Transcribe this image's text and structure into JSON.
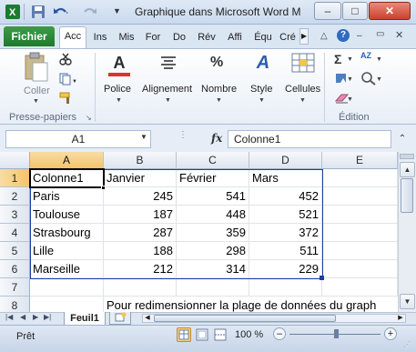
{
  "window": {
    "title": "Graphique dans Microsoft Word M",
    "minimize": "–",
    "maximize": "□",
    "close": "✕"
  },
  "ribbon": {
    "file_tab": "Fichier",
    "tabs": [
      "Acc",
      "Ins",
      "Mis",
      "For",
      "Do",
      "Rév",
      "Affi",
      "Équ",
      "Cré"
    ],
    "active_tab_index": 0,
    "clipboard": {
      "paste_label": "Coller",
      "group_label": "Presse-papiers"
    },
    "buttons": {
      "font": "Police",
      "alignment": "Alignement",
      "number": "Nombre",
      "style": "Style",
      "cells": "Cellules"
    },
    "editing_group_label": "Édition",
    "icons": {
      "font": "A",
      "number": "%",
      "style": "A",
      "sum": "Σ",
      "sort": "AZ"
    }
  },
  "formula_bar": {
    "name_box": "A1",
    "fx": "fx",
    "value": "Colonne1"
  },
  "grid": {
    "columns": [
      "A",
      "B",
      "C",
      "D",
      "E"
    ],
    "rows": [
      "1",
      "2",
      "3",
      "4",
      "5",
      "6",
      "7",
      "8"
    ],
    "cells": [
      [
        "Colonne1",
        "Janvier",
        "Février",
        "Mars",
        ""
      ],
      [
        "Paris",
        "245",
        "541",
        "452",
        ""
      ],
      [
        "Toulouse",
        "187",
        "448",
        "521",
        ""
      ],
      [
        "Strasbourg",
        "287",
        "359",
        "372",
        ""
      ],
      [
        "Lille",
        "188",
        "298",
        "511",
        ""
      ],
      [
        "Marseille",
        "212",
        "314",
        "229",
        ""
      ],
      [
        "",
        "",
        "",
        "",
        ""
      ],
      [
        "",
        "",
        "",
        "",
        ""
      ]
    ],
    "note": "Pour redimensionner la plage de données du graph",
    "range_color": "#1f3f9f"
  },
  "sheets": {
    "tabs": [
      "Feuil1"
    ],
    "active": "Feuil1"
  },
  "statusbar": {
    "status": "Prêt",
    "zoom": "100 %",
    "zoom_out": "–",
    "zoom_in": "+"
  },
  "colors": {
    "accent": "#1f7a2b",
    "selection": "#f3c46c"
  }
}
